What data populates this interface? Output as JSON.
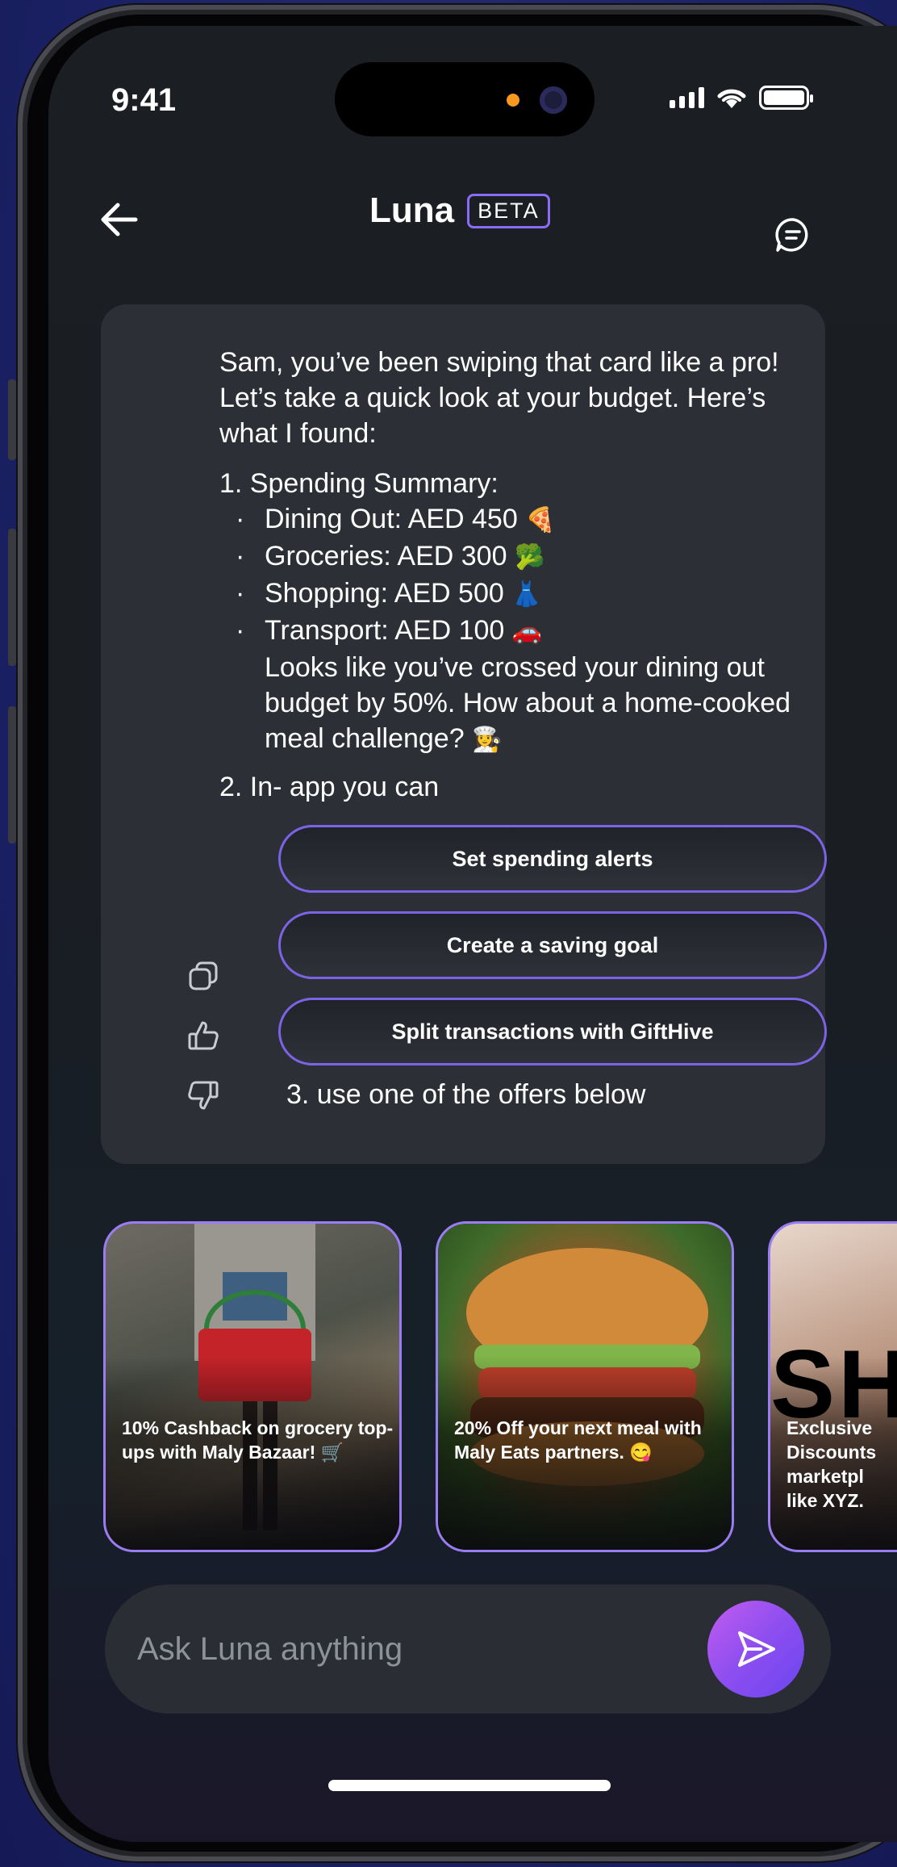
{
  "status_bar": {
    "time": "9:41",
    "icons": [
      "signal-icon",
      "wifi-icon",
      "battery-icon"
    ]
  },
  "header": {
    "title": "Luna",
    "badge": "BETA",
    "back_icon": "arrow-left-icon",
    "chat_icon": "chat-bubble-icon"
  },
  "message": {
    "intro": "Sam, you’ve been swiping that card like a pro! Let’s take a quick look at your budget. Here’s what I found:",
    "summary_title": "1. Spending Summary:",
    "items": [
      {
        "label": "Dining Out: AED 450",
        "emoji": "🍕"
      },
      {
        "label": "Groceries: AED 300",
        "emoji": "🥦"
      },
      {
        "label": "Shopping: AED 500",
        "emoji": "👗"
      },
      {
        "label": "Transport: AED 100",
        "emoji": "🚗"
      }
    ],
    "note": "Looks like you’ve crossed your dining out budget by 50%. How about a home-cooked meal challenge?",
    "note_emoji": "👩‍🍳",
    "step2": "2. In- app you can",
    "actions": [
      "Set spending alerts",
      "Create a saving goal",
      "Split transactions with GiftHive"
    ],
    "step3": "3. use one of the offers below",
    "feedback_icons": [
      "copy-icon",
      "thumbs-up-icon",
      "thumbs-down-icon"
    ]
  },
  "offers": [
    {
      "text": "10% Cashback on grocery top-ups with Maly Bazaar! 🛒"
    },
    {
      "text": "20% Off your next meal with Maly Eats partners. 😋"
    },
    {
      "text": "Exclusive Discounts marketpl like XYZ.",
      "brand_fragment": "SH"
    }
  ],
  "composer": {
    "placeholder": "Ask Luna anything",
    "send_icon": "send-icon"
  },
  "colors": {
    "accent": "#8b6cf6",
    "send_gradient_start": "#c35cf0",
    "send_gradient_end": "#6a45ef",
    "bubble": "#2c2f35",
    "background": "#1b2266"
  }
}
